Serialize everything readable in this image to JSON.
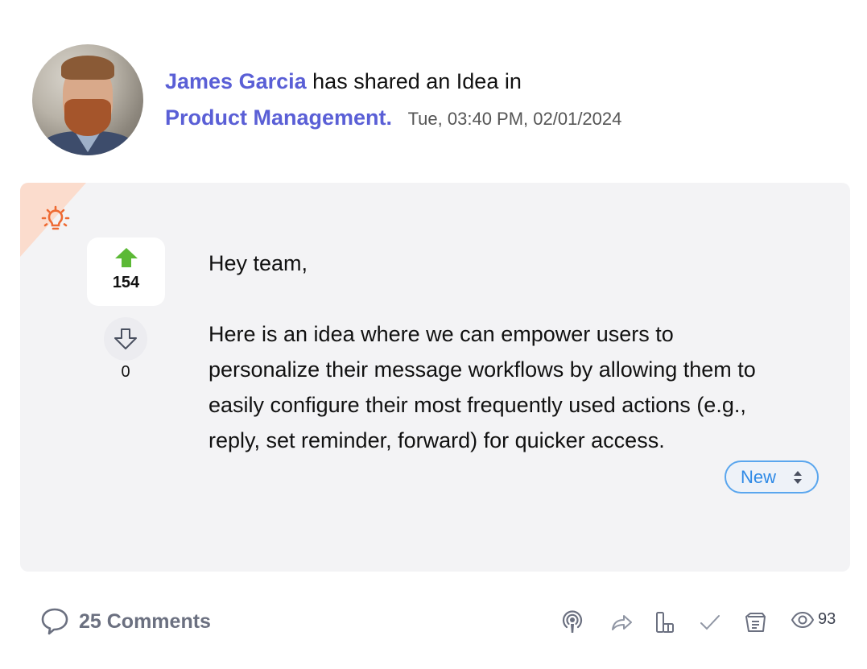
{
  "post": {
    "author": "James Garcia",
    "action_text": "has shared an Idea in",
    "community": "Product Management.",
    "timestamp": "Tue, 03:40 PM, 02/01/2024",
    "avatar_icon": "user-avatar-photo"
  },
  "idea": {
    "type_icon": "lightbulb-icon",
    "upvotes": "154",
    "downvotes": "0",
    "body": [
      "Hey team,",
      "Here is an idea where we can empower users to personalize their message workflows by allowing them to easily configure their most frequently used actions (e.g., reply, set reminder, forward) for quicker access."
    ],
    "status": "New"
  },
  "footer": {
    "comments_label": "25 Comments",
    "views": "93",
    "actions": [
      "podcast-icon",
      "share-icon",
      "chart-icon",
      "check-icon",
      "notes-icon"
    ]
  },
  "colors": {
    "author": "#5a5fd6",
    "upvote": "#5cb936",
    "bulb": "#ee6a33",
    "status": "#2f8ae6"
  }
}
